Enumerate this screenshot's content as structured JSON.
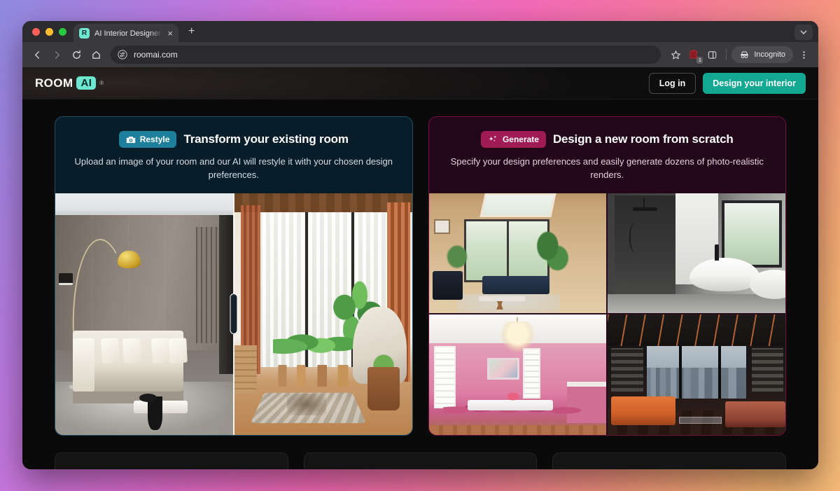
{
  "browser": {
    "tab": {
      "title": "AI Interior Designer – Try for f",
      "favicon_letter": "R",
      "close_label": "×"
    },
    "new_tab_label": "+",
    "toolbar": {
      "back_label": "←",
      "forward_label": "→",
      "reload_label": "⟳",
      "home_label": "⌂",
      "url": "roomai.com",
      "bookmark_label": "☆",
      "extension_count": "1",
      "incognito_label": "Incognito",
      "menu_label": "⋮"
    }
  },
  "site": {
    "logo": {
      "word": "ROOM",
      "badge": "AI",
      "registered": "®"
    },
    "header": {
      "login_label": "Log in",
      "cta_label": "Design your interior"
    },
    "cards": [
      {
        "pill": "Restyle",
        "pill_icon": "camera-icon",
        "title": "Transform your existing room",
        "subtitle": "Upload an image of your room and our AI will restyle it with your chosen design preferences.",
        "accent": "#1d7f9b",
        "background": "#081d2a",
        "border": "#1d4f63",
        "media_type": "before-after-slider"
      },
      {
        "pill": "Generate",
        "pill_icon": "sparkles-icon",
        "title": "Design a new room from scratch",
        "subtitle": "Specify your design preferences and easily generate dozens of photo-realistic renders.",
        "accent": "#a01a56",
        "background": "#23061a",
        "border": "#6e1040",
        "media_type": "render-grid"
      }
    ]
  },
  "colors": {
    "brand_teal": "#6ee7d0",
    "cta_teal": "#12a892",
    "page_background": "#0a0a0a",
    "desktop_gradient_start": "#8f8ae0",
    "desktop_gradient_mid": "#f46bb8",
    "desktop_gradient_end": "#f6bb79"
  }
}
